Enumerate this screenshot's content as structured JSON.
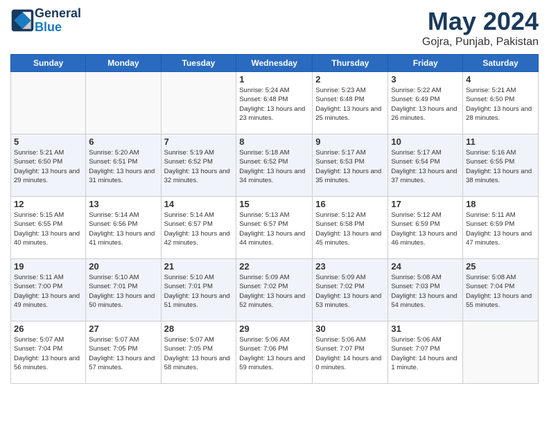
{
  "header": {
    "logo_line1": "General",
    "logo_line2": "Blue",
    "month_title": "May 2024",
    "location": "Gojra, Punjab, Pakistan"
  },
  "days_of_week": [
    "Sunday",
    "Monday",
    "Tuesday",
    "Wednesday",
    "Thursday",
    "Friday",
    "Saturday"
  ],
  "weeks": [
    [
      {
        "day": "",
        "info": ""
      },
      {
        "day": "",
        "info": ""
      },
      {
        "day": "",
        "info": ""
      },
      {
        "day": "1",
        "info": "Sunrise: 5:24 AM\nSunset: 6:48 PM\nDaylight: 13 hours\nand 23 minutes."
      },
      {
        "day": "2",
        "info": "Sunrise: 5:23 AM\nSunset: 6:48 PM\nDaylight: 13 hours\nand 25 minutes."
      },
      {
        "day": "3",
        "info": "Sunrise: 5:22 AM\nSunset: 6:49 PM\nDaylight: 13 hours\nand 26 minutes."
      },
      {
        "day": "4",
        "info": "Sunrise: 5:21 AM\nSunset: 6:50 PM\nDaylight: 13 hours\nand 28 minutes."
      }
    ],
    [
      {
        "day": "5",
        "info": "Sunrise: 5:21 AM\nSunset: 6:50 PM\nDaylight: 13 hours\nand 29 minutes."
      },
      {
        "day": "6",
        "info": "Sunrise: 5:20 AM\nSunset: 6:51 PM\nDaylight: 13 hours\nand 31 minutes."
      },
      {
        "day": "7",
        "info": "Sunrise: 5:19 AM\nSunset: 6:52 PM\nDaylight: 13 hours\nand 32 minutes."
      },
      {
        "day": "8",
        "info": "Sunrise: 5:18 AM\nSunset: 6:52 PM\nDaylight: 13 hours\nand 34 minutes."
      },
      {
        "day": "9",
        "info": "Sunrise: 5:17 AM\nSunset: 6:53 PM\nDaylight: 13 hours\nand 35 minutes."
      },
      {
        "day": "10",
        "info": "Sunrise: 5:17 AM\nSunset: 6:54 PM\nDaylight: 13 hours\nand 37 minutes."
      },
      {
        "day": "11",
        "info": "Sunrise: 5:16 AM\nSunset: 6:55 PM\nDaylight: 13 hours\nand 38 minutes."
      }
    ],
    [
      {
        "day": "12",
        "info": "Sunrise: 5:15 AM\nSunset: 6:55 PM\nDaylight: 13 hours\nand 40 minutes."
      },
      {
        "day": "13",
        "info": "Sunrise: 5:14 AM\nSunset: 6:56 PM\nDaylight: 13 hours\nand 41 minutes."
      },
      {
        "day": "14",
        "info": "Sunrise: 5:14 AM\nSunset: 6:57 PM\nDaylight: 13 hours\nand 42 minutes."
      },
      {
        "day": "15",
        "info": "Sunrise: 5:13 AM\nSunset: 6:57 PM\nDaylight: 13 hours\nand 44 minutes."
      },
      {
        "day": "16",
        "info": "Sunrise: 5:12 AM\nSunset: 6:58 PM\nDaylight: 13 hours\nand 45 minutes."
      },
      {
        "day": "17",
        "info": "Sunrise: 5:12 AM\nSunset: 6:59 PM\nDaylight: 13 hours\nand 46 minutes."
      },
      {
        "day": "18",
        "info": "Sunrise: 5:11 AM\nSunset: 6:59 PM\nDaylight: 13 hours\nand 47 minutes."
      }
    ],
    [
      {
        "day": "19",
        "info": "Sunrise: 5:11 AM\nSunset: 7:00 PM\nDaylight: 13 hours\nand 49 minutes."
      },
      {
        "day": "20",
        "info": "Sunrise: 5:10 AM\nSunset: 7:01 PM\nDaylight: 13 hours\nand 50 minutes."
      },
      {
        "day": "21",
        "info": "Sunrise: 5:10 AM\nSunset: 7:01 PM\nDaylight: 13 hours\nand 51 minutes."
      },
      {
        "day": "22",
        "info": "Sunrise: 5:09 AM\nSunset: 7:02 PM\nDaylight: 13 hours\nand 52 minutes."
      },
      {
        "day": "23",
        "info": "Sunrise: 5:09 AM\nSunset: 7:02 PM\nDaylight: 13 hours\nand 53 minutes."
      },
      {
        "day": "24",
        "info": "Sunrise: 5:08 AM\nSunset: 7:03 PM\nDaylight: 13 hours\nand 54 minutes."
      },
      {
        "day": "25",
        "info": "Sunrise: 5:08 AM\nSunset: 7:04 PM\nDaylight: 13 hours\nand 55 minutes."
      }
    ],
    [
      {
        "day": "26",
        "info": "Sunrise: 5:07 AM\nSunset: 7:04 PM\nDaylight: 13 hours\nand 56 minutes."
      },
      {
        "day": "27",
        "info": "Sunrise: 5:07 AM\nSunset: 7:05 PM\nDaylight: 13 hours\nand 57 minutes."
      },
      {
        "day": "28",
        "info": "Sunrise: 5:07 AM\nSunset: 7:05 PM\nDaylight: 13 hours\nand 58 minutes."
      },
      {
        "day": "29",
        "info": "Sunrise: 5:06 AM\nSunset: 7:06 PM\nDaylight: 13 hours\nand 59 minutes."
      },
      {
        "day": "30",
        "info": "Sunrise: 5:06 AM\nSunset: 7:07 PM\nDaylight: 14 hours\nand 0 minutes."
      },
      {
        "day": "31",
        "info": "Sunrise: 5:06 AM\nSunset: 7:07 PM\nDaylight: 14 hours\nand 1 minute."
      },
      {
        "day": "",
        "info": ""
      }
    ]
  ]
}
